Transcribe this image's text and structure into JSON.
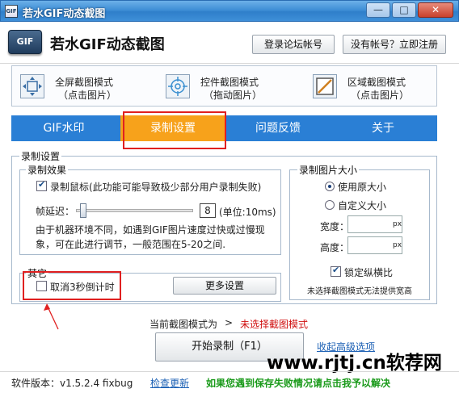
{
  "window": {
    "title": "若水GIF动态截图",
    "icon_text": "GIF",
    "controls": {
      "minimize": "—",
      "maximize": "□",
      "close": "✕"
    }
  },
  "header": {
    "logo_text": "GIF",
    "app_name": "若水GIF动态截图",
    "login_button": "登录论坛帐号",
    "register_button": "没有帐号？立即注册"
  },
  "modes": [
    {
      "icon": "fullscreen-icon",
      "line1": "全屏截图模式",
      "line2": "（点击图片）"
    },
    {
      "icon": "control-capture-icon",
      "line1": "控件截图模式",
      "line2": "（拖动图片）"
    },
    {
      "icon": "region-capture-icon",
      "line1": "区域截图模式",
      "line2": "（点击图片）"
    }
  ],
  "tabs": [
    {
      "label": "GIF水印",
      "active": false
    },
    {
      "label": "录制设置",
      "active": true
    },
    {
      "label": "问题反馈",
      "active": false
    },
    {
      "label": "关于",
      "active": false
    }
  ],
  "record_settings": {
    "group_title": "录制设置",
    "effect": {
      "title": "录制效果",
      "record_mouse_label": "录制鼠标(此功能可能导致极少部分用户录制失败)",
      "record_mouse_checked": true,
      "delay_label": "帧延迟：",
      "delay_value": "8",
      "delay_unit": "(单位:10ms)",
      "delay_slider_fraction": 0.04,
      "hint_line1": "由于机器环境不同，如遇到GIF图片速度过快或过慢现",
      "hint_line2": "象，可在此进行调节，一般范围在5-20之间."
    },
    "other": {
      "title": "其它",
      "cancel_countdown_label": "取消3秒倒计时",
      "cancel_countdown_checked": false,
      "more_settings_button": "更多设置"
    },
    "size": {
      "title": "录制图片大小",
      "original_label": "使用原大小",
      "original_checked": true,
      "custom_label": "自定义大小",
      "custom_checked": false,
      "width_label": "宽度：",
      "height_label": "高度：",
      "width_value": "",
      "height_value": "",
      "unit": "px",
      "lock_ratio_label": "锁定纵横比",
      "lock_ratio_checked": true,
      "note": "未选择截图模式无法提供宽高"
    }
  },
  "bottom": {
    "current_mode_label": "当前截图模式为",
    "arrow": ">",
    "current_mode_value": "未选择截图模式",
    "start_button": "开始录制（F1）",
    "collapse_link": "收起高级选项"
  },
  "footer": {
    "version_label": "软件版本：v1.5.2.4 fixbug",
    "check_update": "检查更新",
    "notice": "如果您遇到保存失败情况请点击我予以解决"
  },
  "watermark": "www.rjtj.cn软荐网",
  "colors": {
    "tab_bar": "#2a7fd5",
    "tab_active": "#f7a21b",
    "annotation_red": "#e02020",
    "mode_value_red": "#d01010",
    "notice_green": "#1a9a1a",
    "link_blue": "#1a5fb4"
  }
}
